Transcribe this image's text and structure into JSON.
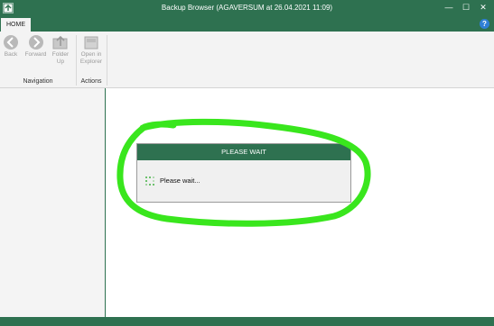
{
  "window": {
    "title": "Backup Browser (AGAVERSUM at 26.04.2021 11:09)",
    "controls": {
      "minimize": "—",
      "maximize": "☐",
      "close": "✕"
    }
  },
  "tabs": {
    "home": "HOME",
    "help": "?"
  },
  "ribbon": {
    "navigation": {
      "back": "Back",
      "forward": "Forward",
      "folder_up_line1": "Folder",
      "folder_up_line2": "Up",
      "group_label": "Navigation"
    },
    "actions": {
      "open_in_explorer_line1": "Open in",
      "open_in_explorer_line2": "Explorer",
      "group_label": "Actions"
    }
  },
  "dialog": {
    "header": "PLEASE WAIT",
    "message": "Please wait..."
  },
  "colors": {
    "brand_green": "#2e7150",
    "highlight_green": "#39e61d",
    "spinner_green": "#6cc06c"
  }
}
